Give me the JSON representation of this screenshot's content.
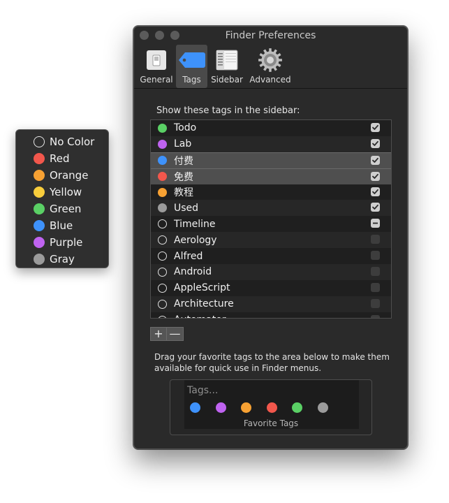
{
  "color_popup": {
    "items": [
      {
        "label": "No Color",
        "color": "none"
      },
      {
        "label": "Red",
        "color": "#f2574c"
      },
      {
        "label": "Orange",
        "color": "#f7a133"
      },
      {
        "label": "Yellow",
        "color": "#f8cd3c"
      },
      {
        "label": "Green",
        "color": "#5ad065"
      },
      {
        "label": "Blue",
        "color": "#3e92fb"
      },
      {
        "label": "Purple",
        "color": "#bf63f0"
      },
      {
        "label": "Gray",
        "color": "#9b9b9b"
      }
    ]
  },
  "window": {
    "title": "Finder Preferences",
    "toolbar": [
      {
        "label": "General",
        "icon": "general-switch-icon",
        "active": false
      },
      {
        "label": "Tags",
        "icon": "tag-icon",
        "active": true
      },
      {
        "label": "Sidebar",
        "icon": "sidebar-icon",
        "active": false
      },
      {
        "label": "Advanced",
        "icon": "gear-icon",
        "active": false
      }
    ],
    "section_label": "Show these tags in the sidebar:",
    "tags": [
      {
        "name": "Todo",
        "color": "#5ad065",
        "checked": "on"
      },
      {
        "name": "Lab",
        "color": "#bf63f0",
        "checked": "on"
      },
      {
        "name": "付费",
        "color": "#3e92fb",
        "checked": "on",
        "selected": true
      },
      {
        "name": "免费",
        "color": "#f2574c",
        "checked": "on",
        "selected": true
      },
      {
        "name": "教程",
        "color": "#f7a133",
        "checked": "on"
      },
      {
        "name": "Used",
        "color": "#9b9b9b",
        "checked": "on"
      },
      {
        "name": "Timeline",
        "color": "none",
        "checked": "mixed"
      },
      {
        "name": "Aerology",
        "color": "none",
        "checked": "off"
      },
      {
        "name": "Alfred",
        "color": "none",
        "checked": "off"
      },
      {
        "name": "Android",
        "color": "none",
        "checked": "off"
      },
      {
        "name": "AppleScript",
        "color": "none",
        "checked": "off"
      },
      {
        "name": "Architecture",
        "color": "none",
        "checked": "off"
      },
      {
        "name": "Automator",
        "color": "none",
        "checked": "off"
      }
    ],
    "add_label": "+",
    "remove_label": "—",
    "description": "Drag your favorite tags to the area below to make them available for quick use in Finder menus.",
    "favorites": {
      "placeholder": "Tags...",
      "colors": [
        "#3e92fb",
        "#bf63f0",
        "#f7a133",
        "#f2574c",
        "#5ad065",
        "#9b9b9b"
      ],
      "caption": "Favorite Tags"
    }
  }
}
